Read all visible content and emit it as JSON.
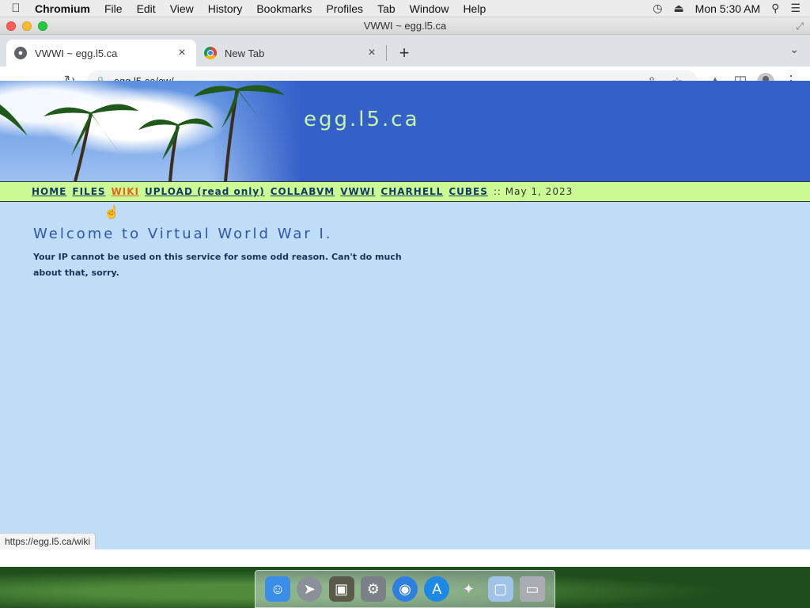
{
  "menubar": {
    "app_name": "Chromium",
    "items": [
      "File",
      "Edit",
      "View",
      "History",
      "Bookmarks",
      "Profiles",
      "Tab",
      "Window",
      "Help"
    ],
    "clock": "Mon 5:30 AM"
  },
  "window": {
    "title": "VWWI ~ egg.l5.ca"
  },
  "tabs": [
    {
      "label": "VWWI ~ egg.l5.ca",
      "active": true
    },
    {
      "label": "New Tab",
      "active": false
    }
  ],
  "toolbar": {
    "url": "egg.l5.ca/cw/"
  },
  "page": {
    "site_title": "egg.l5.ca",
    "nav": [
      {
        "label": "HOME"
      },
      {
        "label": "FILES"
      },
      {
        "label": "WIKI",
        "hover": true
      },
      {
        "label": "UPLOAD (read only)"
      },
      {
        "label": "COLLABVM"
      },
      {
        "label": "VWWI"
      },
      {
        "label": "CHARHELL"
      },
      {
        "label": "CUBES"
      }
    ],
    "date": ":: May 1, 2023",
    "heading": "Welcome to Virtual World War I.",
    "message": "Your IP cannot be used on this service for some odd reason. Can't do much about that, sorry.",
    "colors": {
      "banner": "#3460c9",
      "nav_bg": "#ccfb95",
      "page_bg": "#c0ddf8",
      "link": "#123a66",
      "link_hover": "#e0651a"
    }
  },
  "status_bar": {
    "url": "https://egg.l5.ca/wiki"
  },
  "dock": {
    "icons": [
      "finder-icon",
      "launchpad-icon",
      "photo-browser-icon",
      "system-preferences-icon",
      "chromium-icon",
      "app-store-icon",
      "feather-app-icon",
      "downloads-folder-icon",
      "trash-icon"
    ]
  }
}
